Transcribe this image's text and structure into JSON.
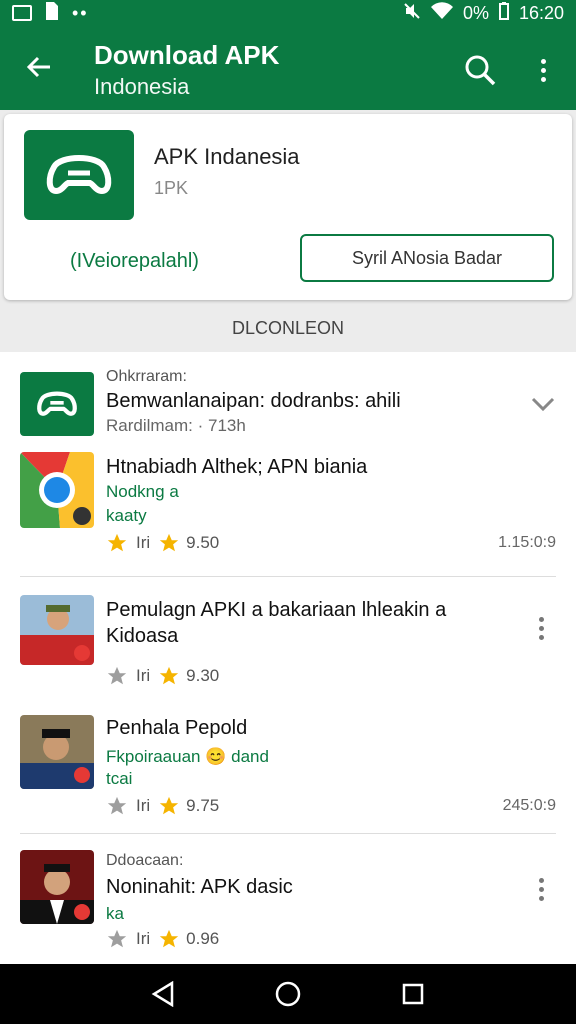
{
  "status_bar": {
    "left_icons": [
      "image-icon",
      "sim-icon",
      "dots-icon"
    ],
    "right_icons": [
      "mute-icon",
      "wifi-icon"
    ],
    "battery": "0%",
    "time": "16:20"
  },
  "app_bar": {
    "title": "Download APK",
    "subtitle": "Indonesia",
    "back_icon": "arrow-left-icon",
    "search_icon": "search-icon",
    "more_icon": "more-vert-icon"
  },
  "app_card": {
    "name": "APK Indanesia",
    "size": "1PK",
    "developer_link": "(IVeiorepalahl)",
    "action_button": "Syril ANosia Badar",
    "logo_icon": "controller-icon"
  },
  "section_header": "DLCONLEON",
  "items": [
    {
      "subtitle": "Ohkrraram:",
      "title": "Bemwanlanaipan: dodranbs: ahili",
      "meta": "Rardilmam: · 713h",
      "thumb": "controller-icon",
      "trailing": "chevron-down-icon"
    },
    {
      "title": "Htnabiadh Althek; APN biania",
      "green": "Nodkng a",
      "green2": "kaaty",
      "rating_text": "Iri",
      "rating": "9.50",
      "time": "1.15:0:9",
      "thumb": "chrome-logo"
    },
    {
      "title": "Pemulagn APKI a bakariaan lhleakin a",
      "title2": "Kidoasa",
      "rating_text": "Iri",
      "rating": "9.30",
      "thumb": "person-photo",
      "trailing": "more-vert-icon"
    },
    {
      "title": "Penhala Pepold",
      "green": "Fkpoiraauan 😊 dand",
      "green2": "tcai",
      "rating_text": "Iri",
      "rating": "9.75",
      "time": "245:0:9",
      "thumb": "person-photo"
    },
    {
      "subtitle": "Ddoacaan:",
      "title": "Noninahit: APK dasic",
      "green": "ka",
      "rating_text": "Iri",
      "rating": "0.96",
      "thumb": "person-photo",
      "trailing": "more-vert-icon"
    }
  ],
  "nav_bar": {
    "buttons": [
      "back-triangle-icon",
      "home-circle-icon",
      "recents-square-icon"
    ]
  },
  "colors": {
    "primary": "#0b7a42",
    "star": "#f5b400",
    "star_empty": "#9e9e9e"
  }
}
